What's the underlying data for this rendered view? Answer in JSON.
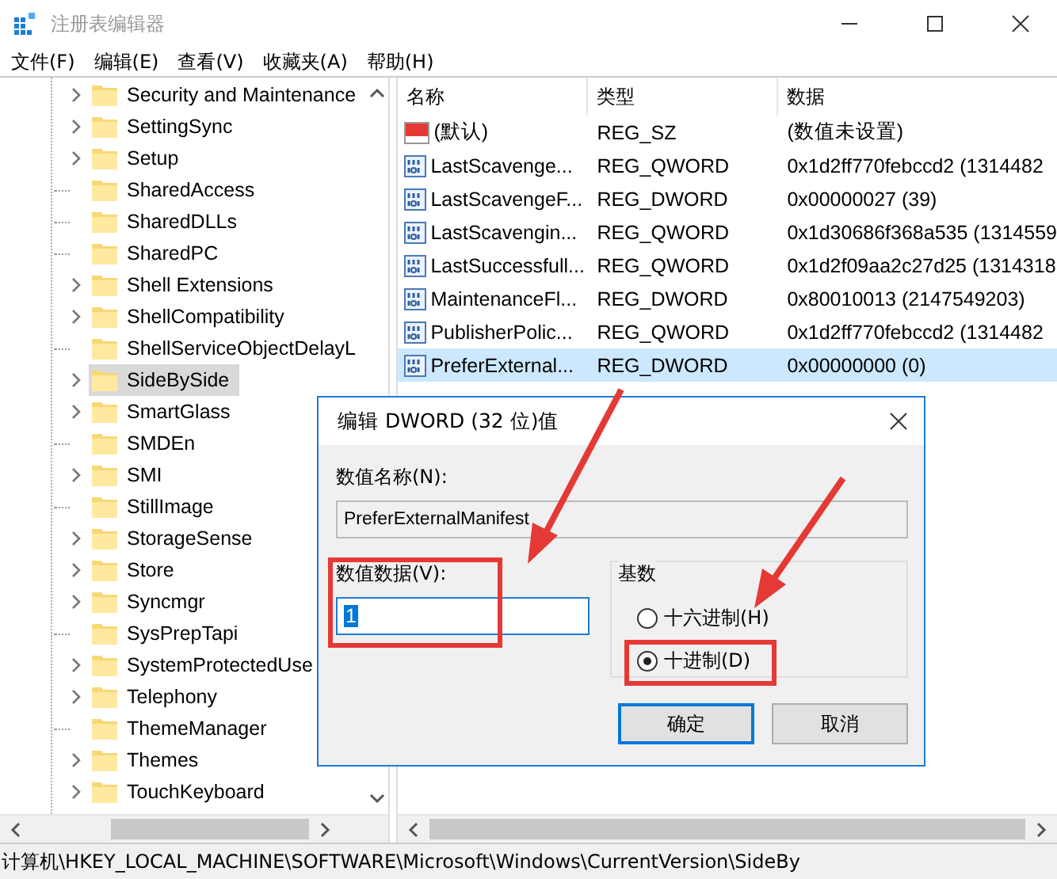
{
  "window": {
    "title": "注册表编辑器"
  },
  "menu": [
    "文件(F)",
    "编辑(E)",
    "查看(V)",
    "收藏夹(A)",
    "帮助(H)"
  ],
  "tree": {
    "items": [
      {
        "label": "Security and Maintenance",
        "expandable": true,
        "selected": false
      },
      {
        "label": "SettingSync",
        "expandable": true,
        "selected": false
      },
      {
        "label": "Setup",
        "expandable": true,
        "selected": false
      },
      {
        "label": "SharedAccess",
        "expandable": false,
        "selected": false
      },
      {
        "label": "SharedDLLs",
        "expandable": false,
        "selected": false
      },
      {
        "label": "SharedPC",
        "expandable": false,
        "selected": false
      },
      {
        "label": "Shell Extensions",
        "expandable": true,
        "selected": false
      },
      {
        "label": "ShellCompatibility",
        "expandable": true,
        "selected": false
      },
      {
        "label": "ShellServiceObjectDelayL",
        "expandable": false,
        "selected": false
      },
      {
        "label": "SideBySide",
        "expandable": true,
        "selected": true
      },
      {
        "label": "SmartGlass",
        "expandable": true,
        "selected": false
      },
      {
        "label": "SMDEn",
        "expandable": false,
        "selected": false
      },
      {
        "label": "SMI",
        "expandable": true,
        "selected": false
      },
      {
        "label": "StillImage",
        "expandable": false,
        "selected": false
      },
      {
        "label": "StorageSense",
        "expandable": true,
        "selected": false
      },
      {
        "label": "Store",
        "expandable": true,
        "selected": false
      },
      {
        "label": "Syncmgr",
        "expandable": true,
        "selected": false
      },
      {
        "label": "SysPrepTapi",
        "expandable": false,
        "selected": false
      },
      {
        "label": "SystemProtectedUse",
        "expandable": true,
        "selected": false
      },
      {
        "label": "Telephony",
        "expandable": true,
        "selected": false
      },
      {
        "label": "ThemeManager",
        "expandable": false,
        "selected": false
      },
      {
        "label": "Themes",
        "expandable": true,
        "selected": false
      },
      {
        "label": "TouchKeyboard",
        "expandable": true,
        "selected": false
      }
    ]
  },
  "values": {
    "columns": [
      "名称",
      "类型",
      "数据"
    ],
    "rows": [
      {
        "kind": "string",
        "name": "(默认)",
        "type": "REG_SZ",
        "data": "(数值未设置)",
        "selected": false
      },
      {
        "kind": "binary",
        "name": "LastScavenge...",
        "type": "REG_QWORD",
        "data": "0x1d2ff770febccd2 (1314482",
        "selected": false
      },
      {
        "kind": "binary",
        "name": "LastScavengeF...",
        "type": "REG_DWORD",
        "data": "0x00000027 (39)",
        "selected": false
      },
      {
        "kind": "binary",
        "name": "LastScavengin...",
        "type": "REG_QWORD",
        "data": "0x1d30686f368a535 (1314559",
        "selected": false
      },
      {
        "kind": "binary",
        "name": "LastSuccessfull...",
        "type": "REG_QWORD",
        "data": "0x1d2f09aa2c27d25 (1314318",
        "selected": false
      },
      {
        "kind": "binary",
        "name": "MaintenanceFl...",
        "type": "REG_DWORD",
        "data": "0x80010013 (2147549203)",
        "selected": false
      },
      {
        "kind": "binary",
        "name": "PublisherPolic...",
        "type": "REG_QWORD",
        "data": "0x1d2ff770febccd2 (1314482",
        "selected": false
      },
      {
        "kind": "binary",
        "name": "PreferExternal...",
        "type": "REG_DWORD",
        "data": "0x00000000 (0)",
        "selected": true
      }
    ]
  },
  "status_bar": "计算机\\HKEY_LOCAL_MACHINE\\SOFTWARE\\Microsoft\\Windows\\CurrentVersion\\SideBy",
  "dialog": {
    "title": "编辑 DWORD (32 位)值",
    "name_label": "数值名称(N):",
    "name_value": "PreferExternalManifest",
    "data_label": "数值数据(V):",
    "data_value": "1",
    "base": {
      "label": "基数",
      "options": [
        {
          "label": "十六进制(H)",
          "selected": false
        },
        {
          "label": "十进制(D)",
          "selected": true
        }
      ]
    },
    "buttons": [
      {
        "label": "确定",
        "default": true
      },
      {
        "label": "取消",
        "default": false
      }
    ]
  }
}
